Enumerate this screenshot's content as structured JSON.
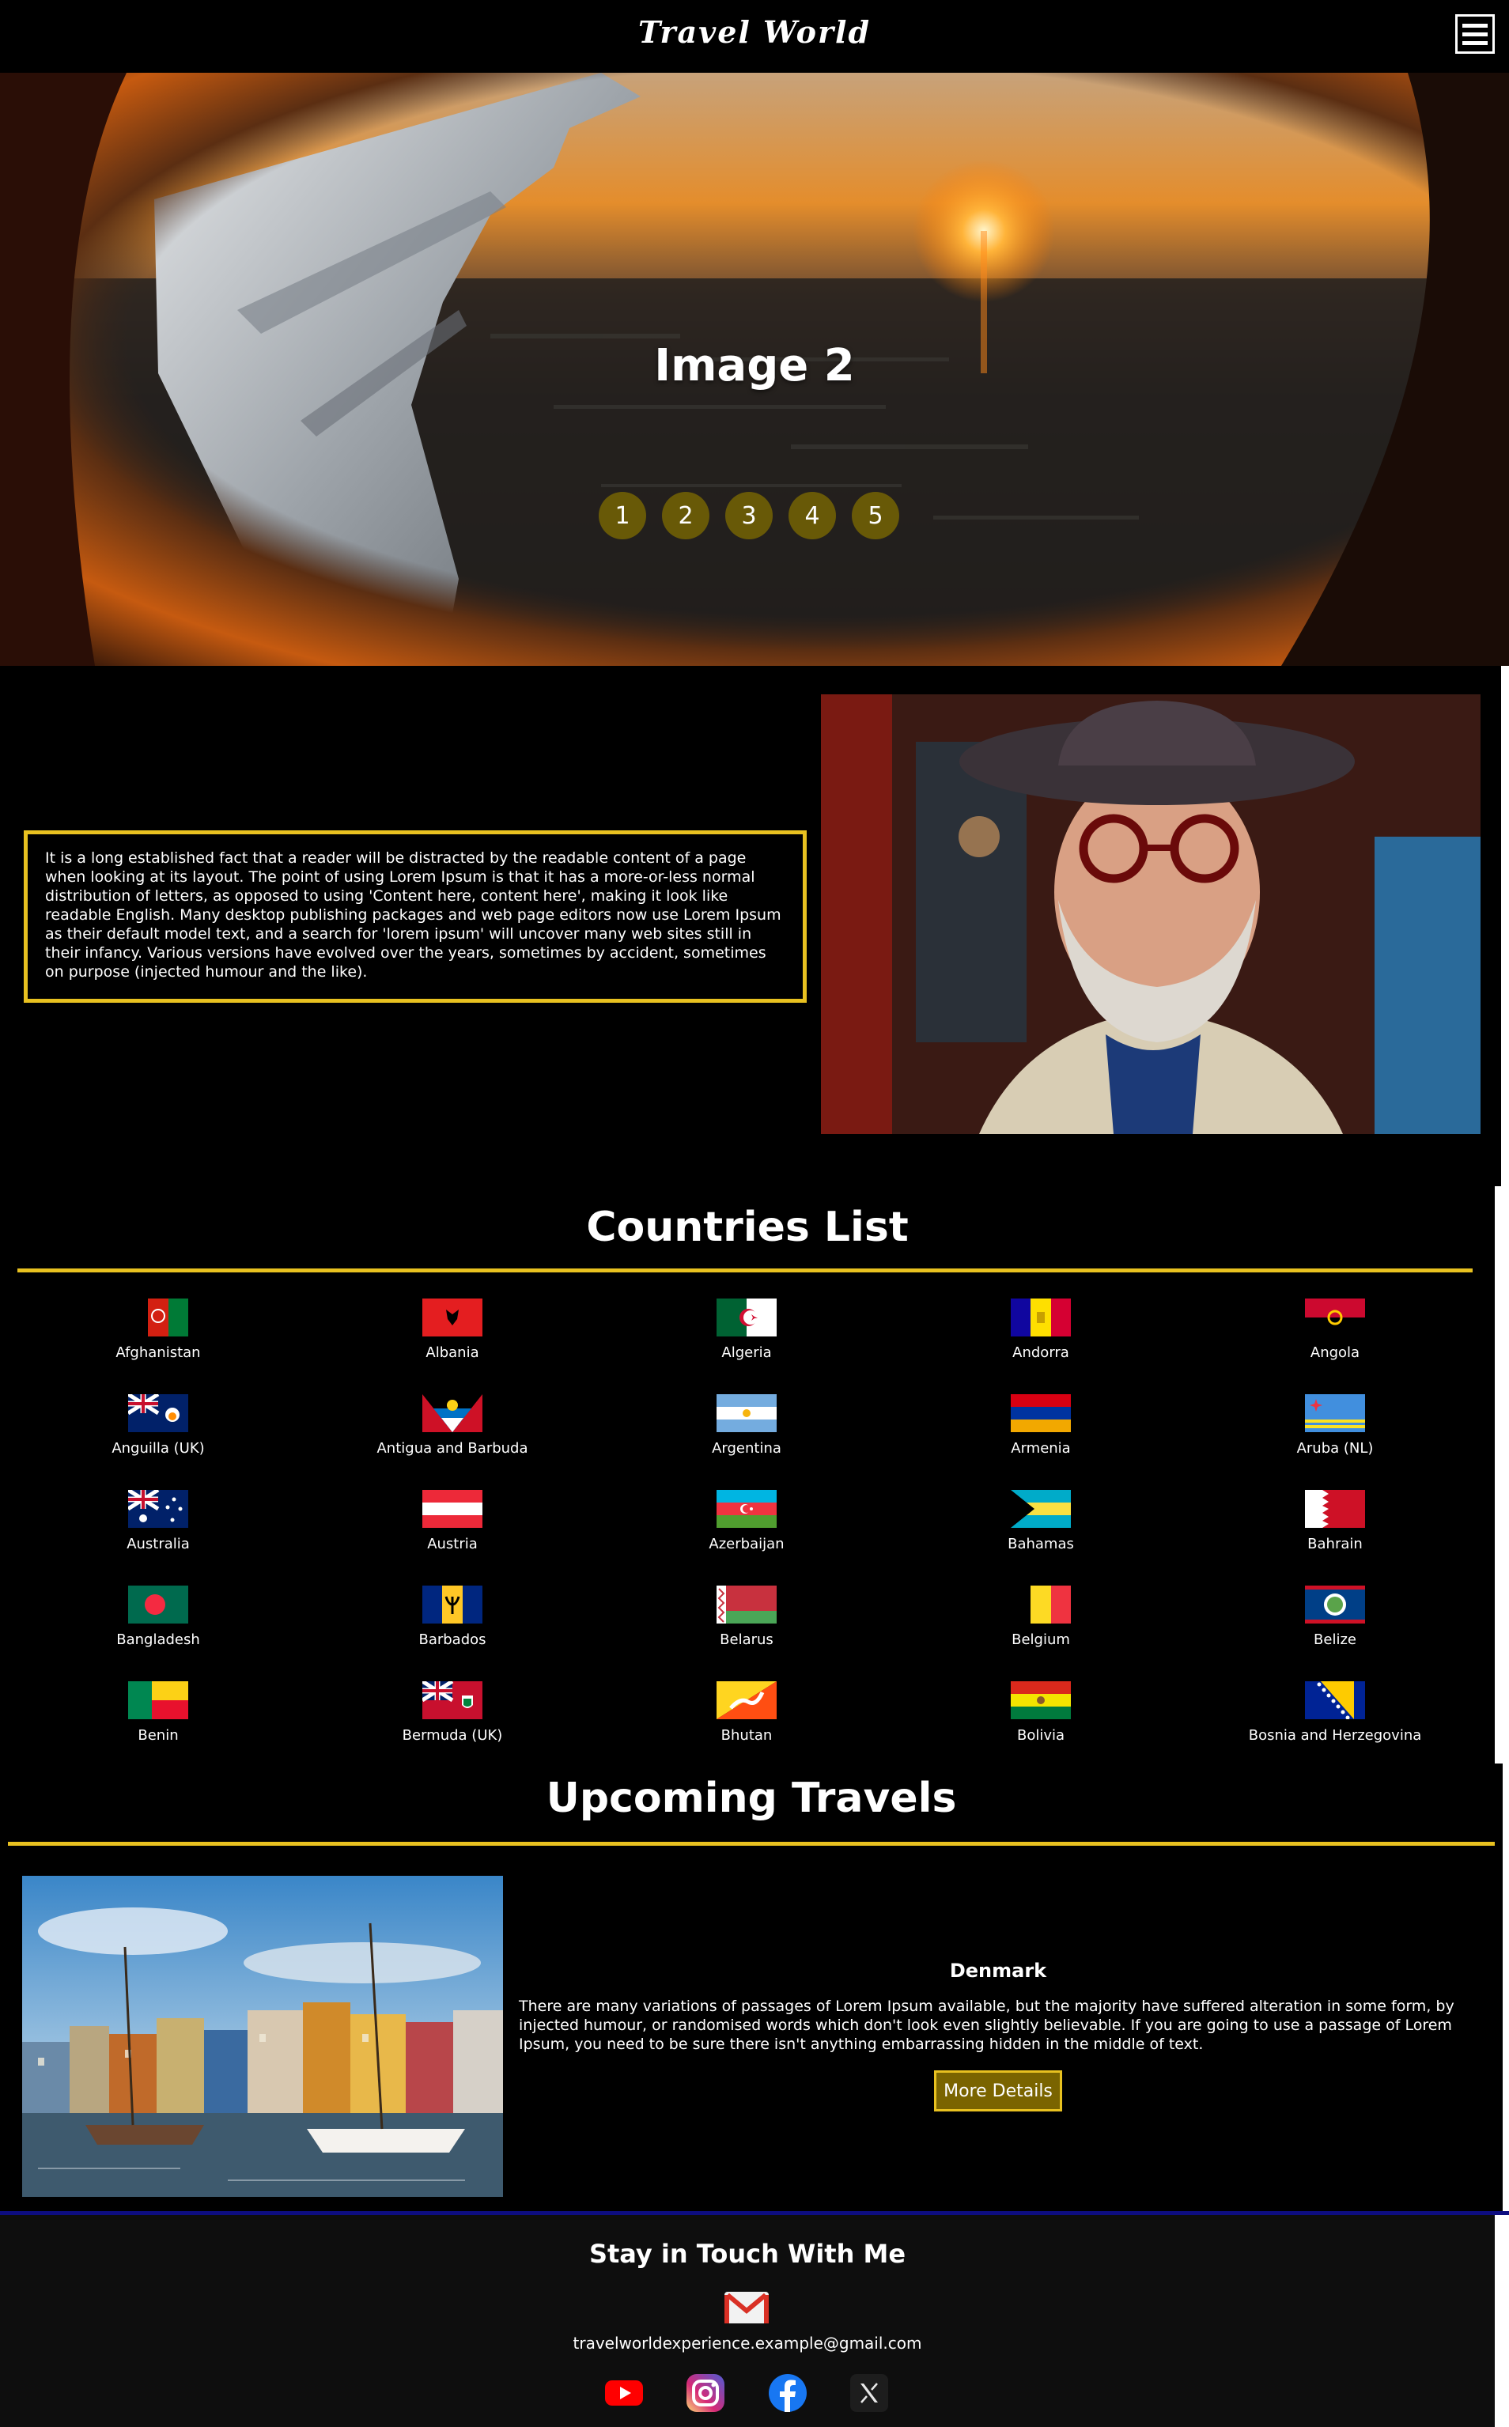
{
  "header": {
    "title": "Travel World",
    "menu_icon": "hamburger-menu-icon"
  },
  "hero": {
    "caption": "Image 2",
    "slides": [
      "1",
      "2",
      "3",
      "4",
      "5"
    ],
    "active_slide": "2"
  },
  "about": {
    "text": "It is a long established fact that a reader will be distracted by the readable content of a page when looking at its layout. The point of using Lorem Ipsum is that it has a more-or-less normal distribution of letters, as opposed to using 'Content here, content here', making it look like readable English. Many desktop publishing packages and web page editors now use Lorem Ipsum as their default model text, and a search for 'lorem ipsum' will uncover many web sites still in their infancy. Various versions have evolved over the years, sometimes by accident, sometimes on purpose (injected humour and the like)."
  },
  "countries": {
    "title": "Countries List",
    "items": [
      {
        "name": "Afghanistan",
        "flag": "afghanistan"
      },
      {
        "name": "Albania",
        "flag": "albania"
      },
      {
        "name": "Algeria",
        "flag": "algeria"
      },
      {
        "name": "Andorra",
        "flag": "andorra"
      },
      {
        "name": "Angola",
        "flag": "angola"
      },
      {
        "name": "Anguilla (UK)",
        "flag": "anguilla"
      },
      {
        "name": "Antigua and Barbuda",
        "flag": "antigua"
      },
      {
        "name": "Argentina",
        "flag": "argentina"
      },
      {
        "name": "Armenia",
        "flag": "armenia"
      },
      {
        "name": "Aruba (NL)",
        "flag": "aruba"
      },
      {
        "name": "Australia",
        "flag": "australia"
      },
      {
        "name": "Austria",
        "flag": "austria"
      },
      {
        "name": "Azerbaijan",
        "flag": "azerbaijan"
      },
      {
        "name": "Bahamas",
        "flag": "bahamas"
      },
      {
        "name": "Bahrain",
        "flag": "bahrain"
      },
      {
        "name": "Bangladesh",
        "flag": "bangladesh"
      },
      {
        "name": "Barbados",
        "flag": "barbados"
      },
      {
        "name": "Belarus",
        "flag": "belarus"
      },
      {
        "name": "Belgium",
        "flag": "belgium"
      },
      {
        "name": "Belize",
        "flag": "belize"
      },
      {
        "name": "Benin",
        "flag": "benin"
      },
      {
        "name": "Bermuda (UK)",
        "flag": "bermuda"
      },
      {
        "name": "Bhutan",
        "flag": "bhutan"
      },
      {
        "name": "Bolivia",
        "flag": "bolivia"
      },
      {
        "name": "Bosnia and Herzegovina",
        "flag": "bosnia"
      }
    ]
  },
  "upcoming": {
    "title": "Upcoming Travels",
    "destination": "Denmark",
    "description": "There are many variations of passages of Lorem Ipsum available, but the majority have suffered alteration in some form, by injected humour, or randomised words which don't look even slightly believable. If you are going to use a passage of Lorem Ipsum, you need to be sure there isn't anything embarrassing hidden in the middle of text.",
    "button": "More Details"
  },
  "footer": {
    "title": "Stay in Touch With Me",
    "email": "travelworldexperience.example@gmail.com",
    "icons": [
      "gmail-icon",
      "youtube-icon",
      "instagram-icon",
      "facebook-icon",
      "x-icon"
    ]
  },
  "colors": {
    "accent_gold": "#e8c120",
    "divider_blue": "#0d0d80",
    "background": "#000000"
  }
}
